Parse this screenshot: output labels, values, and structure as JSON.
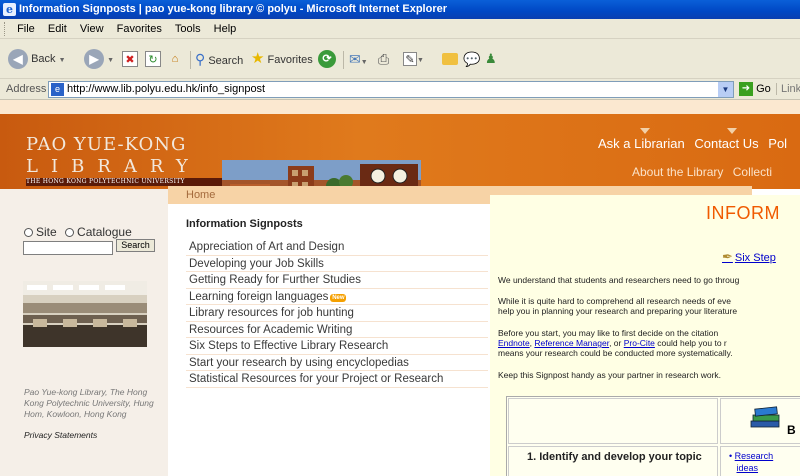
{
  "window": {
    "title": "Information Signposts | pao yue-kong library © polyu - Microsoft Internet Explorer"
  },
  "menu": [
    "File",
    "Edit",
    "View",
    "Favorites",
    "Tools",
    "Help"
  ],
  "toolbar": {
    "back": "Back",
    "search": "Search",
    "favorites": "Favorites"
  },
  "addressbar": {
    "label": "Address",
    "url": "http://www.lib.polyu.edu.hk/info_signpost",
    "go": "Go",
    "links": "Links"
  },
  "banner": {
    "logo_line1": "PAO YUE-KONG",
    "logo_line2": "LIBRARY",
    "logo_line3": "THE HONG KONG POLYTECHNIC UNIVERSITY",
    "nav_top": [
      "Ask a Librarian",
      "Contact Us",
      "Pol"
    ],
    "nav_bottom": [
      "About the Library",
      "Collecti"
    ]
  },
  "sidebar": {
    "search_options": [
      "Site",
      "Catalogue"
    ],
    "search_button": "Search",
    "address": "Pao Yue-kong Library, The Hong Kong Polytechnic University, Hung Hom, Kowloon, Hong Kong",
    "privacy": "Privacy Statements"
  },
  "breadcrumb": "Home",
  "signposts": {
    "heading": "Information Signposts",
    "new_badge": "New",
    "items": [
      "Appreciation of Art and Design",
      "Developing your Job Skills",
      "Getting Ready for Further Studies",
      "Learning foreign languages",
      "Library resources for job hunting",
      "Resources for Academic Writing",
      "Six Steps to Effective Library Research",
      "Start your research by using encyclopedias",
      "Statistical Resources for your Project or Research"
    ]
  },
  "main": {
    "title": "INFORM",
    "six_steps_link": "Six Step",
    "para1": "We understand that students and researchers need to go throug",
    "para2a": "While it is quite hard to comprehend all research needs of eve",
    "para2b": "help you in planning your research and preparing your literature",
    "para3a": "Before you start, you may like to first decide on the citation",
    "para3_link1": "Endnote",
    "para3_sep1": ", ",
    "para3_link2": "Reference Manager",
    "para3_sep2": ", or ",
    "para3_link3": "Pro-Cite",
    "para3b_rest": " could help you to r",
    "para3c": "means your research could be conducted more systematically.",
    "para4": "Keep this Signpost handy as your partner in research work.",
    "table_head_b": "B",
    "step1": "1.  Identify and develop your topic",
    "research_link": [
      "Research",
      "ideas"
    ]
  }
}
